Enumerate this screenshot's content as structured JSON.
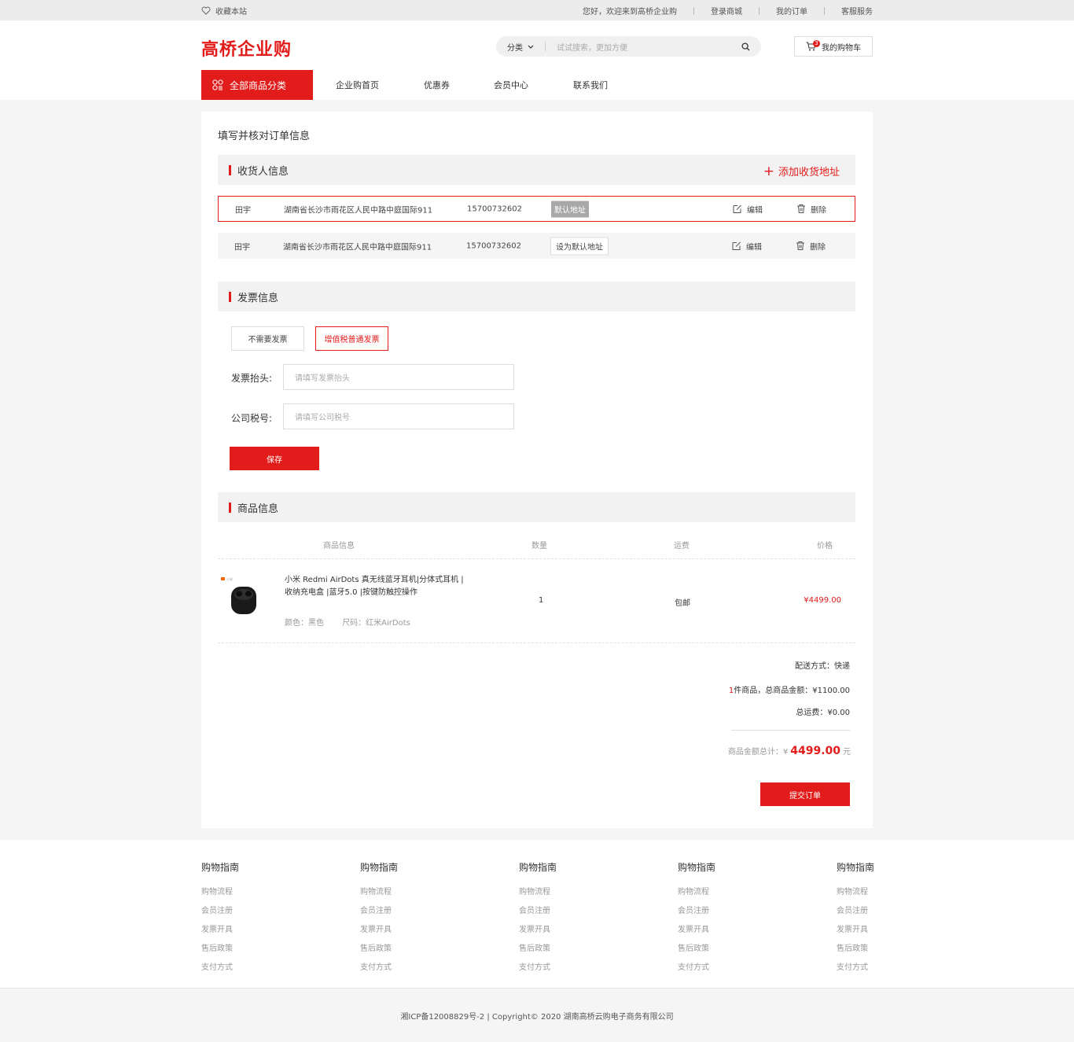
{
  "topbar": {
    "favorite": "收藏本站",
    "welcome": "您好，欢迎来到高桥企业购",
    "login": "登录商城",
    "orders": "我的订单",
    "service": "客服服务"
  },
  "header": {
    "logo": "高桥企业购",
    "search_category": "分类",
    "search_placeholder": "试试搜索，更加方便",
    "cart_label": "我的购物车",
    "cart_count": "3"
  },
  "nav": {
    "all_categories": "全部商品分类",
    "items": [
      "企业购首页",
      "优惠券",
      "会员中心",
      "联系我们"
    ]
  },
  "page_title": "填写并核对订单信息",
  "receiver": {
    "title": "收货人信息",
    "add_label": "添加收货地址",
    "addresses": [
      {
        "name": "田宇",
        "address": "湖南省长沙市雨花区人民中路中庭国际911",
        "phone": "15700732602",
        "tag": "默认地址",
        "edit": "编辑",
        "delete": "删除"
      },
      {
        "name": "田宇",
        "address": "湖南省长沙市雨花区人民中路中庭国际911",
        "phone": "15700732602",
        "tag": "设为默认地址",
        "edit": "编辑",
        "delete": "删除"
      }
    ]
  },
  "invoice": {
    "title": "发票信息",
    "option_none": "不需要发票",
    "option_vat": "增值税普通发票",
    "title_label": "发票抬头:",
    "title_placeholder": "请填写发票抬头",
    "tax_label": "公司税号:",
    "tax_placeholder": "请填写公司税号",
    "save": "保存"
  },
  "products": {
    "title": "商品信息",
    "columns": [
      "商品信息",
      "数量",
      "运费",
      "价格"
    ],
    "items": [
      {
        "brand_tag": "小米",
        "name": "小米 Redmi AirDots 真无线蓝牙耳机|分体式耳机 | 收纳充电盒 |蓝牙5.0 |按键防触控操作",
        "color": "颜色：黑色",
        "size": "尺码：红米AirDots",
        "qty": "1",
        "shipping": "包邮",
        "price": "¥4499.00"
      }
    ]
  },
  "summary": {
    "delivery": "配送方式：快递",
    "count": "1",
    "count_suffix": "件商品，总商品金额：¥1100.00",
    "freight": "总运费：¥0.00",
    "total_label": "商品金额总计：¥",
    "total_amount": "4499.00",
    "total_unit": "元",
    "submit": "提交订单"
  },
  "footer": {
    "columns": [
      {
        "title": "购物指南",
        "links": [
          "购物流程",
          "会员注册",
          "发票开具",
          "售后政策",
          "支付方式"
        ]
      },
      {
        "title": "购物指南",
        "links": [
          "购物流程",
          "会员注册",
          "发票开具",
          "售后政策",
          "支付方式"
        ]
      },
      {
        "title": "购物指南",
        "links": [
          "购物流程",
          "会员注册",
          "发票开具",
          "售后政策",
          "支付方式"
        ]
      },
      {
        "title": "购物指南",
        "links": [
          "购物流程",
          "会员注册",
          "发票开具",
          "售后政策",
          "支付方式"
        ]
      },
      {
        "title": "购物指南",
        "links": [
          "购物流程",
          "会员注册",
          "发票开具",
          "售后政策",
          "支付方式"
        ]
      }
    ],
    "copyright": "湘ICP备12008829号-2 | Copyright©  2020 湖南高桥云购电子商务有限公司"
  },
  "colors": {
    "accent": "#e21b1b",
    "bg": "#f5f5f5"
  }
}
